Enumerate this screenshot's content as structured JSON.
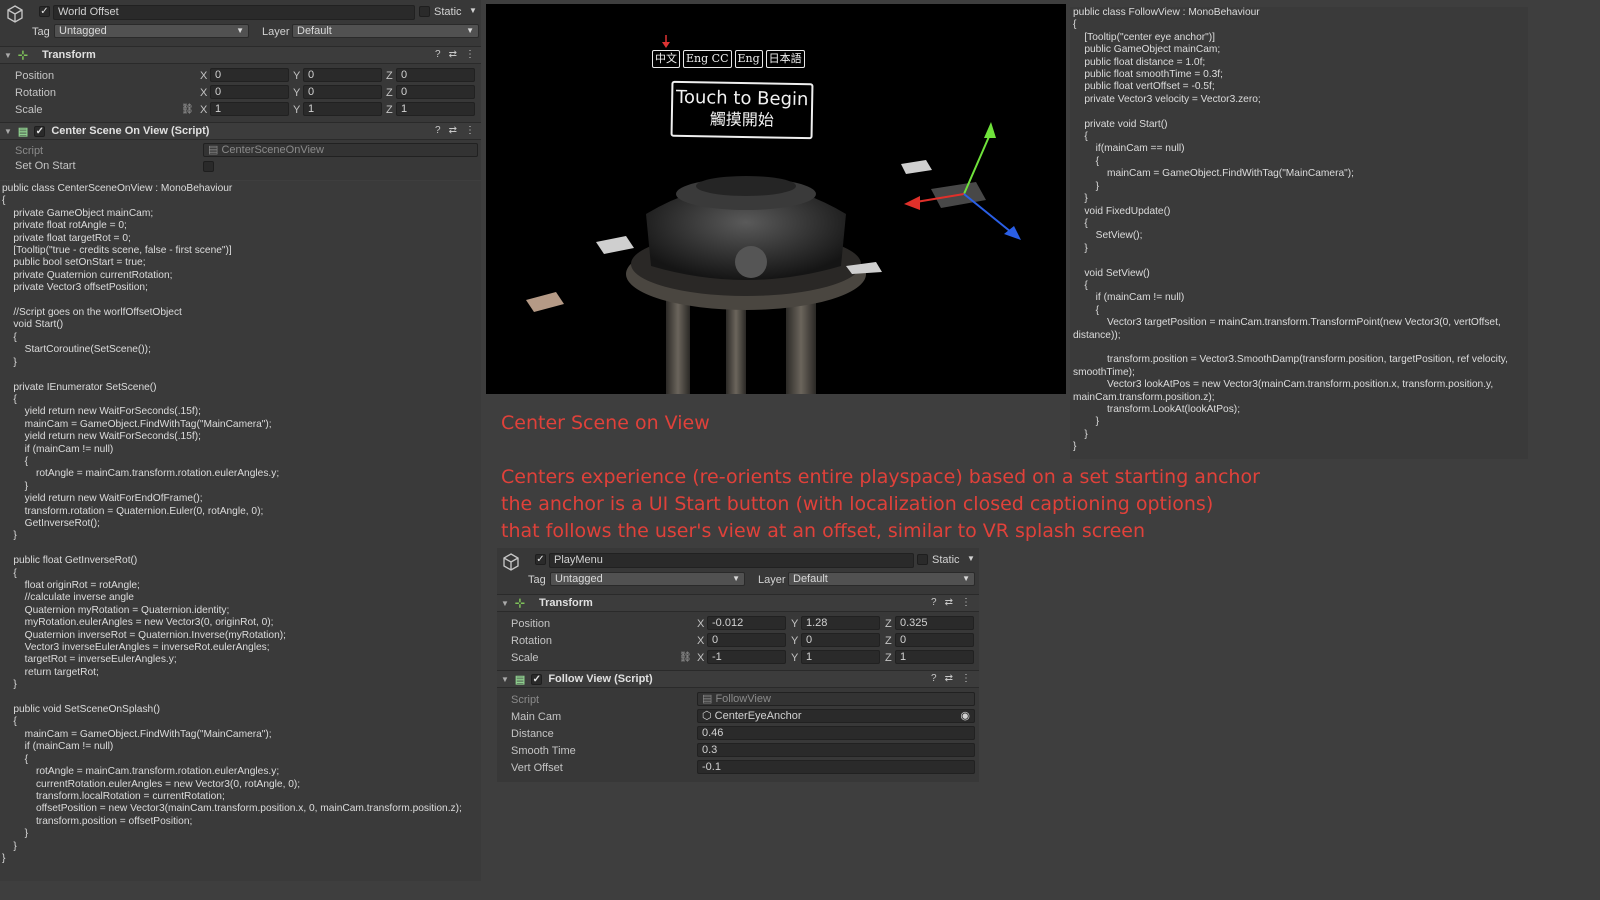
{
  "left_inspector": {
    "object_name": "World Offset",
    "static_label": "Static",
    "tag_label": "Tag",
    "tag_value": "Untagged",
    "layer_label": "Layer",
    "layer_value": "Default",
    "transform": {
      "title": "Transform",
      "rows": [
        {
          "label": "Position",
          "x": "0",
          "y": "0",
          "z": "0"
        },
        {
          "label": "Rotation",
          "x": "0",
          "y": "0",
          "z": "0"
        },
        {
          "label": "Scale",
          "x": "1",
          "y": "1",
          "z": "1"
        }
      ]
    },
    "component": {
      "title": "Center Scene On View (Script)",
      "script_label": "Script",
      "script_value": "CenterSceneOnView",
      "set_on_start_label": "Set On Start"
    }
  },
  "left_code": "public class CenterSceneOnView : MonoBehaviour\n{\n    private GameObject mainCam;\n    private float rotAngle = 0;\n    private float targetRot = 0;\n    [Tooltip(\"true - credits scene, false - first scene\")]\n    public bool setOnStart = true;\n    private Quaternion currentRotation;\n    private Vector3 offsetPosition;\n\n    //Script goes on the worlfOffsetObject\n    void Start()\n    {\n        StartCoroutine(SetScene());\n    }\n\n    private IEnumerator SetScene()\n    {\n        yield return new WaitForSeconds(.15f);\n        mainCam = GameObject.FindWithTag(\"MainCamera\");\n        yield return new WaitForSeconds(.15f);\n        if (mainCam != null)\n        {\n            rotAngle = mainCam.transform.rotation.eulerAngles.y;\n        }\n        yield return new WaitForEndOfFrame();\n        transform.rotation = Quaternion.Euler(0, rotAngle, 0);\n        GetInverseRot();\n    }\n\n    public float GetInverseRot()\n    {\n        float originRot = rotAngle;\n        //calculate inverse angle\n        Quaternion myRotation = Quaternion.identity;\n        myRotation.eulerAngles = new Vector3(0, originRot, 0);\n        Quaternion inverseRot = Quaternion.Inverse(myRotation);\n        Vector3 inverseEulerAngles = inverseRot.eulerAngles;\n        targetRot = inverseEulerAngles.y;\n        return targetRot;\n    }\n\n    public void SetSceneOnSplash()\n    {\n        mainCam = GameObject.FindWithTag(\"MainCamera\");\n        if (mainCam != null)\n        {\n            rotAngle = mainCam.transform.rotation.eulerAngles.y;\n            currentRotation.eulerAngles = new Vector3(0, rotAngle, 0);\n            transform.localRotation = currentRotation;\n            offsetPosition = new Vector3(mainCam.transform.position.x, 0, mainCam.transform.position.z);\n            transform.position = offsetPosition;\n        }\n    }\n}",
  "right_code": "public class FollowView : MonoBehaviour\n{\n    [Tooltip(\"center eye anchor\")]\n    public GameObject mainCam;\n    public float distance = 1.0f;\n    public float smoothTime = 0.3f;\n    public float vertOffset = -0.5f;\n    private Vector3 velocity = Vector3.zero;\n\n    private void Start()\n    {\n        if(mainCam == null)\n        {\n            mainCam = GameObject.FindWithTag(\"MainCamera\");\n        }\n    }\n    void FixedUpdate()\n    {\n        SetView();\n    }\n\n    void SetView()\n    {\n        if (mainCam != null)\n        {\n            Vector3 targetPosition = mainCam.transform.TransformPoint(new Vector3(0, vertOffset,\ndistance));\n\n            transform.position = Vector3.SmoothDamp(transform.position, targetPosition, ref velocity,\nsmoothTime);\n            Vector3 lookAtPos = new Vector3(mainCam.transform.position.x, transform.position.y,\nmainCam.transform.position.z);\n            transform.LookAt(lookAtPos);\n        }\n    }\n}",
  "scene": {
    "lang_buttons": [
      "中文",
      "Eng CC",
      "Eng",
      "日本語"
    ],
    "touch_line1": "Touch to Begin",
    "touch_line2": "觸摸開始"
  },
  "description": {
    "heading": "Center Scene on View",
    "line1": "Centers experience (re-orients entire playspace) based on a set starting anchor",
    "line2": "the anchor is a UI Start button (with localization closed captioning options)",
    "line3": "that follows the user's view at an offset, similar to VR splash screen"
  },
  "bottom_inspector": {
    "object_name": "PlayMenu",
    "static_label": "Static",
    "tag_label": "Tag",
    "tag_value": "Untagged",
    "layer_label": "Layer",
    "layer_value": "Default",
    "transform": {
      "title": "Transform",
      "rows": [
        {
          "label": "Position",
          "x": "-0.012",
          "y": "1.28",
          "z": "0.325"
        },
        {
          "label": "Rotation",
          "x": "0",
          "y": "0",
          "z": "0"
        },
        {
          "label": "Scale",
          "x": "-1",
          "y": "1",
          "z": "1"
        }
      ]
    },
    "component": {
      "title": "Follow View (Script)",
      "script_label": "Script",
      "script_value": "FollowView",
      "main_cam_label": "Main Cam",
      "main_cam_value": "CenterEyeAnchor",
      "distance_label": "Distance",
      "distance_value": "0.46",
      "smooth_time_label": "Smooth Time",
      "smooth_time_value": "0.3",
      "vert_offset_label": "Vert Offset",
      "vert_offset_value": "-0.1"
    }
  },
  "colors": {
    "accent_red": "#e0413a",
    "panel": "#383838",
    "background": "#3e3e3e"
  }
}
